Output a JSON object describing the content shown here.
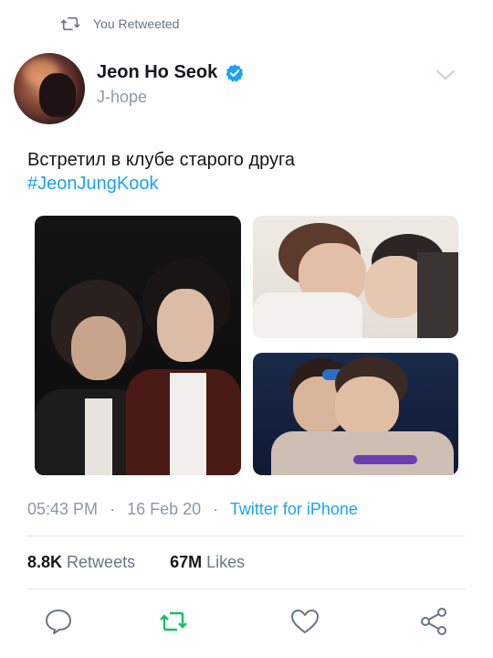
{
  "retweet_banner": {
    "text": "You Retweeted",
    "icon": "retweet-icon"
  },
  "author": {
    "name": "Jeon Ho Seok",
    "handle": "J-hope",
    "verified_icon": "verified-badge-icon",
    "verified_color": "#1da1f2"
  },
  "tweet": {
    "text": "Встретил в клубе старого друга",
    "hashtag": "#JeonJungKook",
    "hashtag_color": "#1da1f2"
  },
  "media": [
    {
      "name": "photo-1"
    },
    {
      "name": "photo-2"
    },
    {
      "name": "photo-3"
    }
  ],
  "meta": {
    "time": "05:43 PM",
    "separator": "·",
    "date": "16 Feb 20",
    "source": "Twitter for iPhone"
  },
  "stats": {
    "retweets_count": "8.8K",
    "retweets_label": "Retweets",
    "likes_count": "67M",
    "likes_label": "Likes"
  },
  "actions": {
    "reply_icon": "reply-icon",
    "retweet_icon": "retweet-icon",
    "retweet_active_color": "#17bf63",
    "like_icon": "heart-icon",
    "share_icon": "share-icon",
    "icon_color": "#657786"
  }
}
